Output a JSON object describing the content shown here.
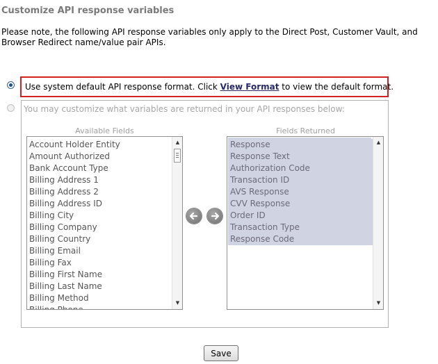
{
  "page": {
    "title": "Customize API response variables",
    "note": "Please note, the following API response variables only apply to the Direct Post, Customer Vault, and Browser Redirect name/value pair APIs."
  },
  "option_default": {
    "text_before": "Use system default API response format. Click ",
    "link": "View Format",
    "text_after": " to view the default format.",
    "checked": true
  },
  "option_custom": {
    "text": "You may customize what variables are returned in your API responses below:",
    "checked": false
  },
  "available": {
    "header": "Available Fields",
    "items": [
      "Account Holder Entity",
      "Amount Authorized",
      "Bank Account Type",
      "Billing Address 1",
      "Billing Address 2",
      "Billing Address ID",
      "Billing City",
      "Billing Company",
      "Billing Country",
      "Billing Email",
      "Billing Fax",
      "Billing First Name",
      "Billing Last Name",
      "Billing Method",
      "Billing Phone"
    ]
  },
  "returned": {
    "header": "Fields Returned",
    "items": [
      "Response",
      "Response Text",
      "Authorization Code",
      "Transaction ID",
      "AVS Response",
      "CVV Response",
      "Order ID",
      "Transaction Type",
      "Response Code"
    ]
  },
  "move_buttons": {
    "left_icon": "arrow-left-icon",
    "right_icon": "arrow-right-icon"
  },
  "save_label": "Save",
  "colors": {
    "highlight_border": "#d42020",
    "selection": "#d0d3e2",
    "link": "#2a2a6a"
  }
}
